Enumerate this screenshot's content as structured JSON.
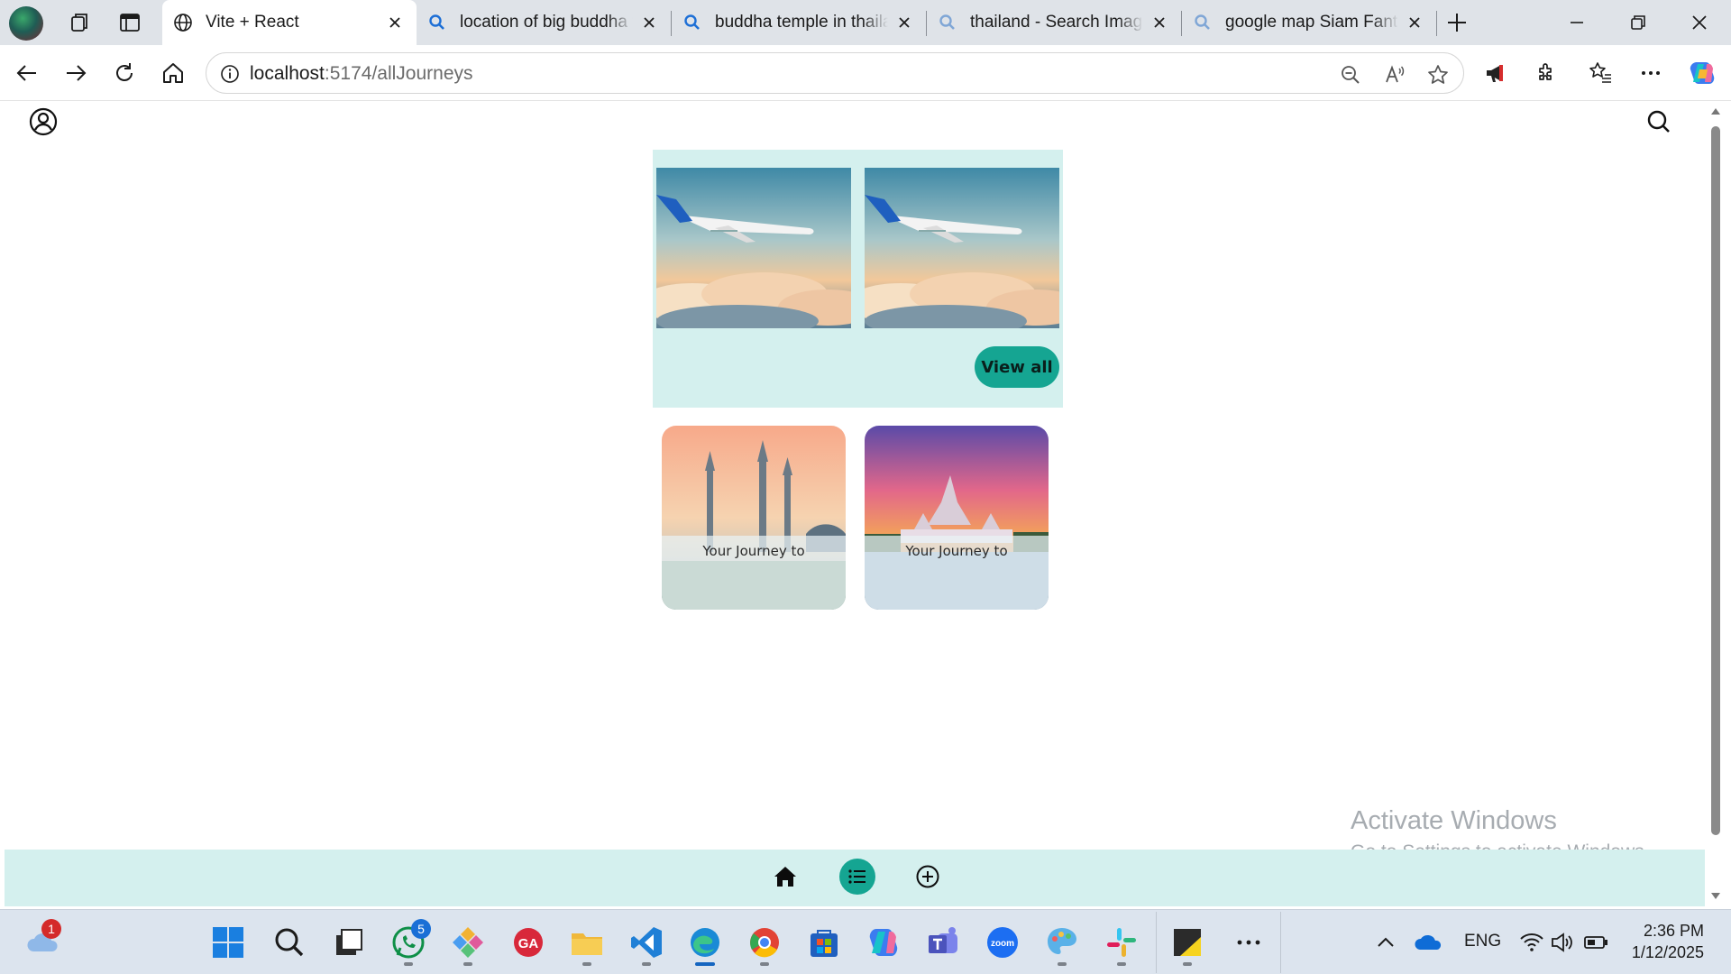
{
  "browser": {
    "tabs": [
      {
        "title": "Vite + React",
        "favicon": "globe-icon",
        "active": true
      },
      {
        "title": "location of big buddha t",
        "favicon": "search-icon",
        "active": false
      },
      {
        "title": "buddha temple in thaila",
        "favicon": "search-icon",
        "active": false
      },
      {
        "title": "thailand - Search Image",
        "favicon": "search-icon",
        "active": false
      },
      {
        "title": "google map Siam Fanta",
        "favicon": "search-icon",
        "active": false
      }
    ],
    "url_host": "localhost",
    "url_path": ":5174/allJourneys"
  },
  "page": {
    "gallery": {
      "photos": [
        "airplane-over-clouds-photo",
        "airplane-over-clouds-photo"
      ],
      "view_all_label": "View all"
    },
    "journeys": [
      {
        "label": "Your Journey to",
        "photo": "mosque-minarets-photo"
      },
      {
        "label": "Your Journey to",
        "photo": "thai-temple-sunset-photo"
      }
    ],
    "bottom_nav": [
      {
        "name": "home",
        "icon": "home-icon",
        "active": false
      },
      {
        "name": "list",
        "icon": "list-icon",
        "active": true
      },
      {
        "name": "add",
        "icon": "plus-circle-icon",
        "active": false
      }
    ],
    "accent_color": "#15a592",
    "panel_color": "#d4f0ee"
  },
  "watermark": {
    "title": "Activate Windows",
    "subtitle": "Go to Settings to activate Windows."
  },
  "taskbar": {
    "weather_badge": "1",
    "whatsapp_badge": "5",
    "zoom_label": "zoom",
    "language": "ENG",
    "time": "2:36 PM",
    "date": "1/12/2025"
  }
}
